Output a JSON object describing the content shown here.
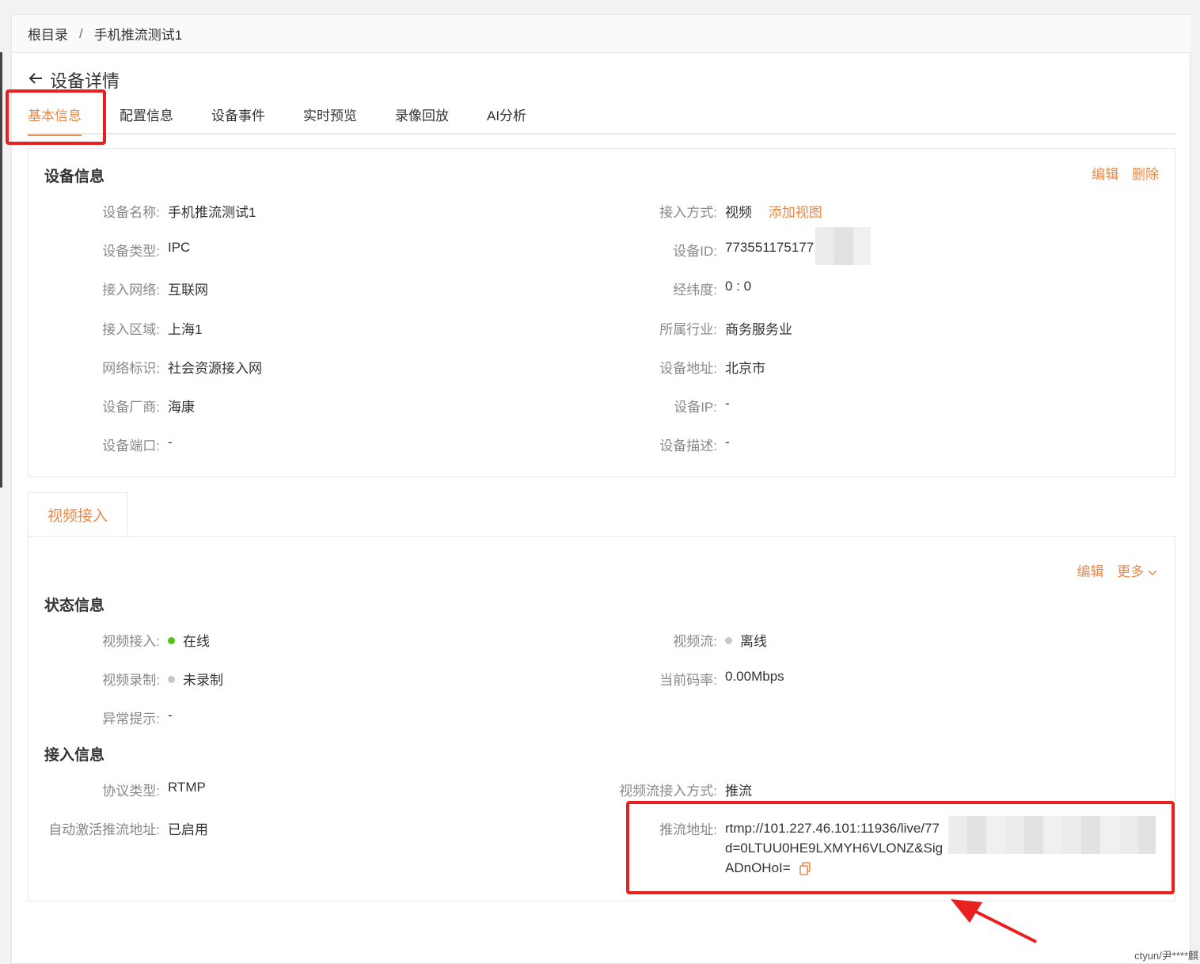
{
  "breadcrumb": {
    "root": "根目录",
    "separator": "/",
    "current": "手机推流测试1"
  },
  "page": {
    "title": "设备详情"
  },
  "tabs": [
    "基本信息",
    "配置信息",
    "设备事件",
    "实时预览",
    "录像回放",
    "AI分析"
  ],
  "device_info": {
    "title": "设备信息",
    "edit": "编辑",
    "delete": "删除",
    "left": [
      {
        "label": "设备名称:",
        "value": "手机推流测试1"
      },
      {
        "label": "设备类型:",
        "value": "IPC"
      },
      {
        "label": "接入网络:",
        "value": "互联网"
      },
      {
        "label": "接入区域:",
        "value": "上海1"
      },
      {
        "label": "网络标识:",
        "value": "社会资源接入网"
      },
      {
        "label": "设备厂商:",
        "value": "海康"
      },
      {
        "label": "设备端口:",
        "value": "-"
      }
    ],
    "right": [
      {
        "label": "接入方式:",
        "value": "视频",
        "extra": "添加视图"
      },
      {
        "label": "设备ID:",
        "value": "773551175177"
      },
      {
        "label": "经纬度:",
        "value": "0 : 0"
      },
      {
        "label": "所属行业:",
        "value": "商务服务业"
      },
      {
        "label": "设备地址:",
        "value": "北京市"
      },
      {
        "label": "设备IP:",
        "value": "-"
      },
      {
        "label": "设备描述:",
        "value": "-"
      }
    ]
  },
  "video_access": {
    "tab": "视频接入",
    "edit": "编辑",
    "more": "更多",
    "status": {
      "title": "状态信息",
      "video_access_label": "视频接入:",
      "video_access_value": "在线",
      "video_stream_label": "视频流:",
      "video_stream_value": "离线",
      "recording_label": "视频录制:",
      "recording_value": "未录制",
      "bitrate_label": "当前码率:",
      "bitrate_value": "0.00Mbps",
      "alert_label": "异常提示:",
      "alert_value": "-"
    },
    "access": {
      "title": "接入信息",
      "protocol_label": "协议类型:",
      "protocol_value": "RTMP",
      "stream_mode_label": "视频流接入方式:",
      "stream_mode_value": "推流",
      "auto_label": "自动激活推流地址:",
      "auto_value": "已启用",
      "push_label": "推流地址:",
      "push_line1": "rtmp://101.227.46.101:11936/live/77",
      "push_line2": "d=0LTUU0HE9LXMYH6VLONZ&Sig",
      "push_line3": "ADnOHoI="
    }
  },
  "colors": {
    "accent": "#e8894a",
    "online": "#52c41a",
    "offline": "#c8c8c8",
    "highlight": "#e8211e"
  },
  "watermark": "ctyun/尹****麒"
}
